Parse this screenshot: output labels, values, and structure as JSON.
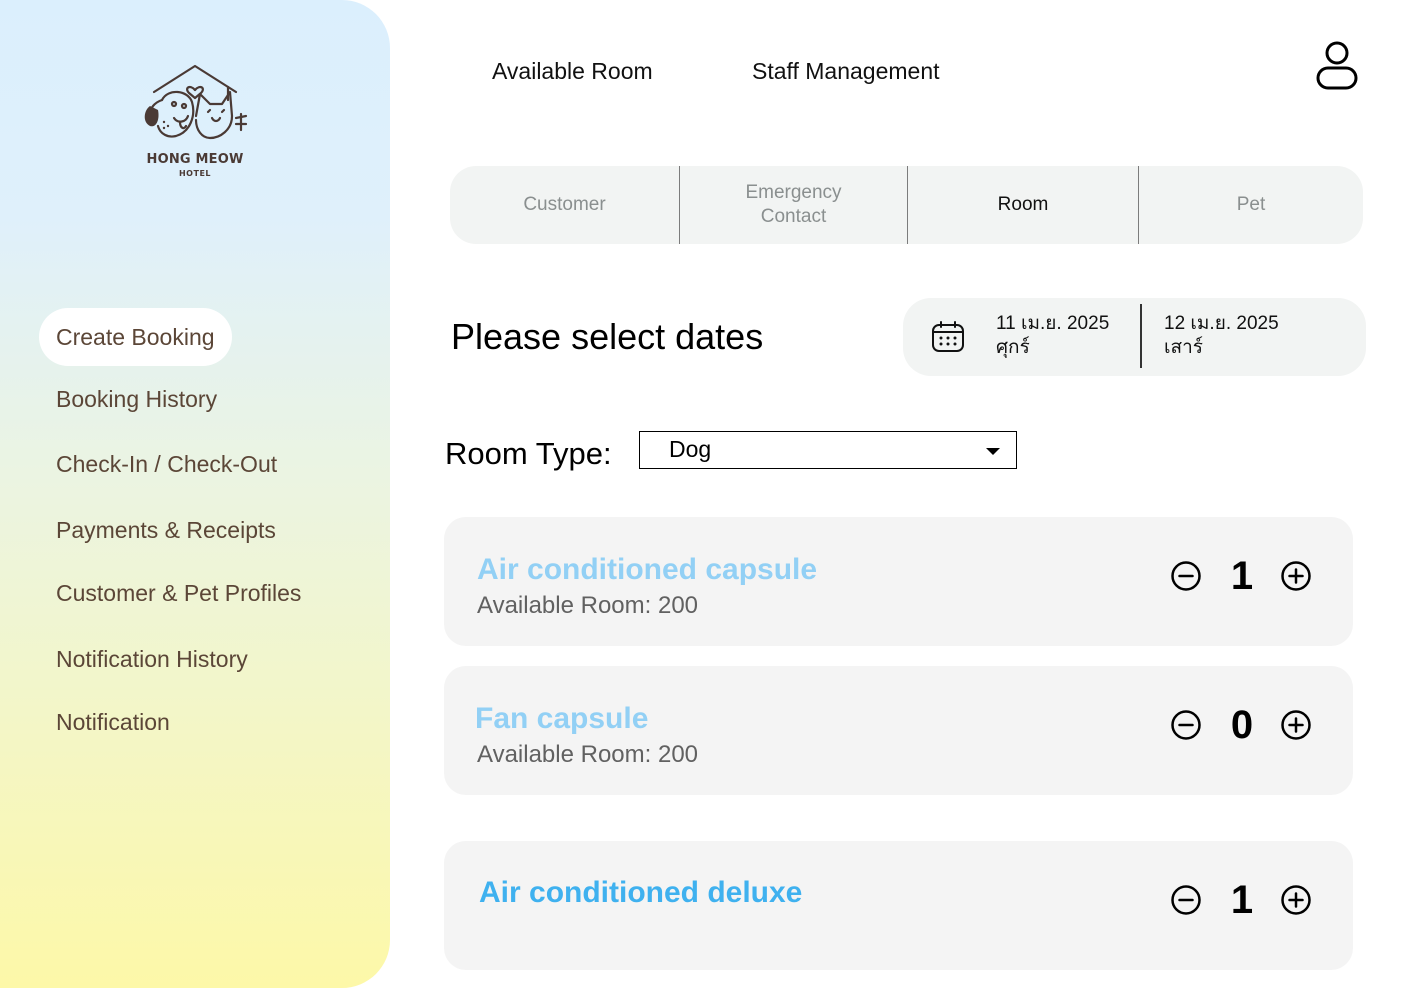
{
  "brand": {
    "name": "HONG MEOW",
    "sub": "HOTEL"
  },
  "sidebar": {
    "items": [
      {
        "label": "Create Booking",
        "active": true
      },
      {
        "label": "Booking History"
      },
      {
        "label": "Check-In / Check-Out"
      },
      {
        "label": "Payments & Receipts"
      },
      {
        "label": "Customer & Pet Profiles"
      },
      {
        "label": "Notification History"
      },
      {
        "label": "Notification"
      }
    ]
  },
  "header": {
    "links": [
      "Available Room",
      "Staff Management"
    ],
    "user_icon": "user-icon"
  },
  "tabs": [
    {
      "label": "Customer"
    },
    {
      "label_line1": "Emergency",
      "label_line2": "Contact"
    },
    {
      "label": "Room",
      "active": true
    },
    {
      "label": "Pet"
    }
  ],
  "dates": {
    "title": "Please select dates",
    "check_in": {
      "date": "11 เม.ย. 2025",
      "day": "ศุกร์"
    },
    "check_out": {
      "date": "12 เม.ย. 2025",
      "day": "เสาร์"
    },
    "icon": "calendar-icon"
  },
  "room_type": {
    "label": "Room Type:",
    "selected": "Dog"
  },
  "rooms": [
    {
      "name": "Air conditioned capsule",
      "availability": "Available Room: 200",
      "quantity": "1",
      "color": "#92d0f5"
    },
    {
      "name": "Fan capsule",
      "availability": "Available Room: 200",
      "quantity": "0",
      "color": "#92d0f5"
    },
    {
      "name": "Air conditioned deluxe",
      "quantity": "1",
      "color": "#3fb1ef"
    }
  ],
  "colors": {
    "nav_text": "#5b4637",
    "tab_inactive": "#8a8f8f",
    "card_bg": "#f4f4f4"
  }
}
